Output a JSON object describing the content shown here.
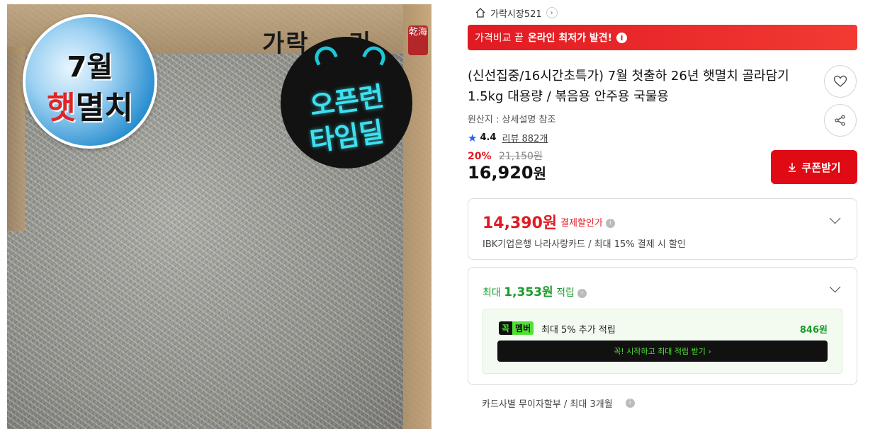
{
  "image": {
    "brand_text": "가락",
    "brand_text_tail": "리",
    "stamp": "乾海",
    "badge_july": {
      "line1": "7월",
      "line2_highlight": "햇",
      "line2_rest": "멸치"
    },
    "badge_open": {
      "line1": "오픈런",
      "line2": "타임딜"
    }
  },
  "store": {
    "name": "가락시장521",
    "icon": "home-icon"
  },
  "banner": {
    "prefix": "가격비교 끝",
    "bold": "온라인 최저가 발견!",
    "icon": "info-icon"
  },
  "product": {
    "title": "(신선집중/16시간초특가) 7월 첫출하 26년 햇멸치 골라담기 1.5kg 대용량 / 볶음용 안주용 국물용",
    "origin": "원산지 : 상세설명 참조",
    "rating": "4.4",
    "reviews": "리뷰 882개",
    "discount": "20%",
    "original_price": "21,150원",
    "price_number": "16,920",
    "price_unit": "원"
  },
  "actions": {
    "coupon_label": "쿠폰받기"
  },
  "card_payment": {
    "price": "14,390원",
    "label": "결제할인가",
    "description": "IBK기업은행 나라사랑카드 / 최대 15% 결제 시 할인"
  },
  "rewards": {
    "prefix": "최대",
    "amount": "1,353원",
    "suffix": "적립",
    "member_badge_1": "꼭",
    "member_badge_2": "멤버",
    "member_text": "최대 5% 추가 적립",
    "member_amount": "846원",
    "member_cta": "꼭! 시작하고 최대 적립 받기 ›"
  },
  "installment": {
    "text": "카드사별 무이자할부 / 최대 3개월"
  },
  "colors": {
    "accent_red": "#e11a22",
    "green": "#1a9b2b",
    "member_green": "#52e036",
    "star_blue": "#2563eb"
  }
}
